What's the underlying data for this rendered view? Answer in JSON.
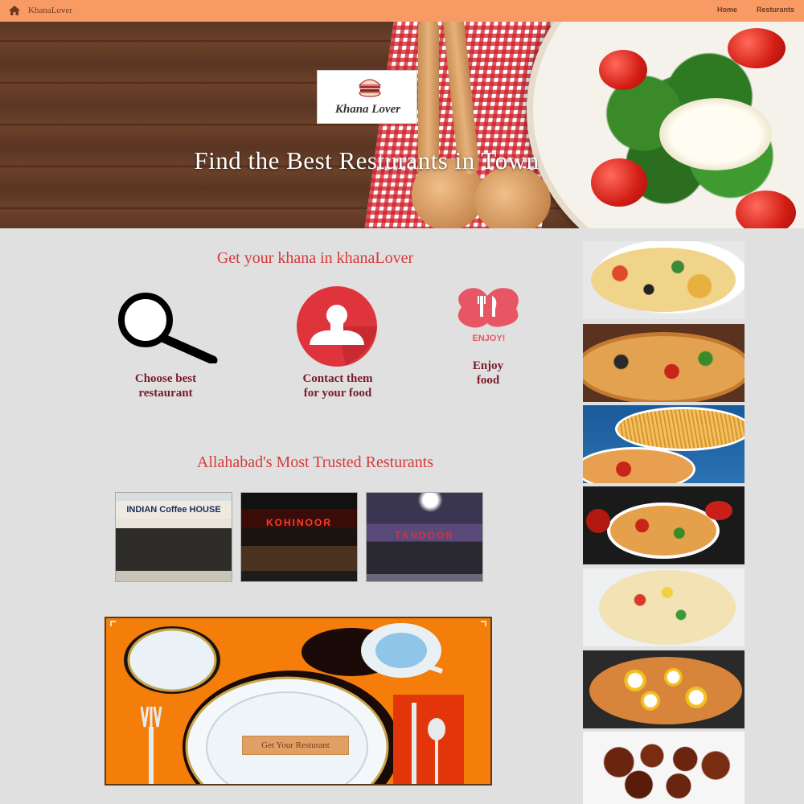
{
  "navbar": {
    "brand": "KhanaLover",
    "links": [
      "Home",
      "Resturants"
    ]
  },
  "hero": {
    "logo_text": "Khana Lover",
    "headline": "Find the Best Resturants in Town"
  },
  "intro": {
    "title": "Get your khana in khanaLover",
    "features": [
      {
        "icon": "search-icon",
        "line1": "Choose best",
        "line2": "restaurant"
      },
      {
        "icon": "contact-icon",
        "line1": "Contact them",
        "line2": "for your food"
      },
      {
        "icon": "enjoy-icon",
        "badge": "ENJOY!",
        "line1": "Enjoy",
        "line2": "food"
      }
    ]
  },
  "trusted": {
    "title": "Allahabad's Most Trusted Resturants",
    "restaurants": [
      "INDIAN Coffee HOUSE",
      "KOHINOOR",
      "TANDOOR"
    ]
  },
  "cta": {
    "button": "Get Your Resturant"
  },
  "sidebar": {
    "dishes": [
      "pasta-salad",
      "pizza",
      "spaghetti-and-pizza",
      "pizza-on-board",
      "uttapam",
      "egg-curry",
      "gulab-jamun"
    ]
  },
  "colors": {
    "navbar": "#f79a63",
    "accent_red": "#d63a3a",
    "feature_text": "#7a1a28",
    "cta_orange": "#f57e0a",
    "background": "#e0e0e0"
  }
}
